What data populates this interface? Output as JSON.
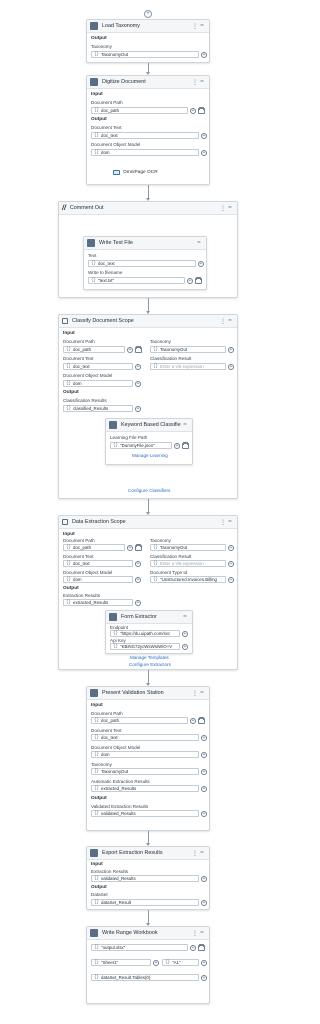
{
  "load_taxonomy": {
    "title": "Load Taxonomy",
    "output": "Output",
    "taxonomy_label": "Taxonomy",
    "taxonomy_value": "TaxonomyOut"
  },
  "digitize": {
    "title": "Digitize Document",
    "input": "Input",
    "doc_path_label": "Document Path",
    "doc_path_value": "doc_path",
    "output": "Output",
    "doc_text_label": "Document Text",
    "doc_text_value": "doc_text",
    "dom_label": "Document Object Model",
    "dom_value": "dom",
    "ocr": "OmniPage OCR"
  },
  "comment_out": {
    "title": "Comment Out",
    "write_text": {
      "title": "Write Text File",
      "text_label": "Text",
      "text_value": "doc_text",
      "write_label": "Write to filename",
      "write_value": "\"text.txt\""
    }
  },
  "classify": {
    "title": "Classify Document Scope",
    "input": "Input",
    "doc_path_label": "Document Path",
    "doc_path_value": "doc_path",
    "taxonomy_label": "Taxonomy",
    "taxonomy_value": "TaxonomyOut",
    "doc_text_label": "Document Text",
    "doc_text_value": "doc_text",
    "class_result_label": "Classification Result",
    "class_result_placeholder": "Enter a VB expression",
    "dom_label": "Document Object Model",
    "dom_value": "dom",
    "output": "Output",
    "results_label": "Classification Results",
    "results_value": "classified_Results",
    "keyword": {
      "title": "Keyword Based Classifier",
      "learning_label": "Learning File Path",
      "learning_value": "\"DummyFile.json\"",
      "manage": "Manage Learning"
    },
    "configure": "Configure Classifiers"
  },
  "extraction": {
    "title": "Data Extraction Scope",
    "input": "Input",
    "doc_path_label": "Document Path",
    "doc_path_value": "doc_path",
    "taxonomy_label": "Taxonomy",
    "taxonomy_value": "TaxonomyOut",
    "doc_text_label": "Document Text",
    "doc_text_value": "doc_text",
    "class_result_label": "Classification Result",
    "class_result_placeholder": "Enter a VB expression",
    "dom_label": "Document Object Model",
    "dom_value": "dom",
    "doc_type_label": "Document Type Id",
    "doc_type_value": "\"Unstructured.Invoices.Billing",
    "output": "Output",
    "results_label": "Extraction Results",
    "results_value": "extracted_Results",
    "form": {
      "title": "Form Extractor",
      "endpoint_label": "Endpoint",
      "endpoint_value": "\"https://du.uipath.com/svc",
      "apikey_label": "Api Key",
      "apikey_value": "\"KBiNG72ycWsWsIWiO+V",
      "manage": "Manage Templates"
    },
    "configure": "Configure Extractors"
  },
  "validation": {
    "title": "Present Validation Station",
    "input": "Input",
    "doc_path_label": "Document Path",
    "doc_path_value": "doc_path",
    "doc_text_label": "Document Text",
    "doc_text_value": "doc_text",
    "dom_label": "Document Object Model",
    "dom_value": "dom",
    "taxonomy_label": "Taxonomy",
    "taxonomy_value": "TaxonomyOut",
    "auto_label": "Automatic Extraction Results",
    "auto_value": "extracted_Results",
    "output": "Output",
    "validated_label": "Validated Extraction Results",
    "validated_value": "validated_Results"
  },
  "export": {
    "title": "Export Extraction Results",
    "input": "Input",
    "results_label": "Extraction Results",
    "results_value": "validated_Results",
    "output": "Output",
    "dataset_label": "DataSet",
    "dataset_value": "dataSet_Result"
  },
  "write_range": {
    "title": "Write Range Workbook",
    "file_value": "\"output.xlsx\"",
    "sheet_value": "\"Sheet1\"",
    "cell_value": "\"A1\"",
    "table_value": "dataSet_Result.Tables(0)"
  }
}
